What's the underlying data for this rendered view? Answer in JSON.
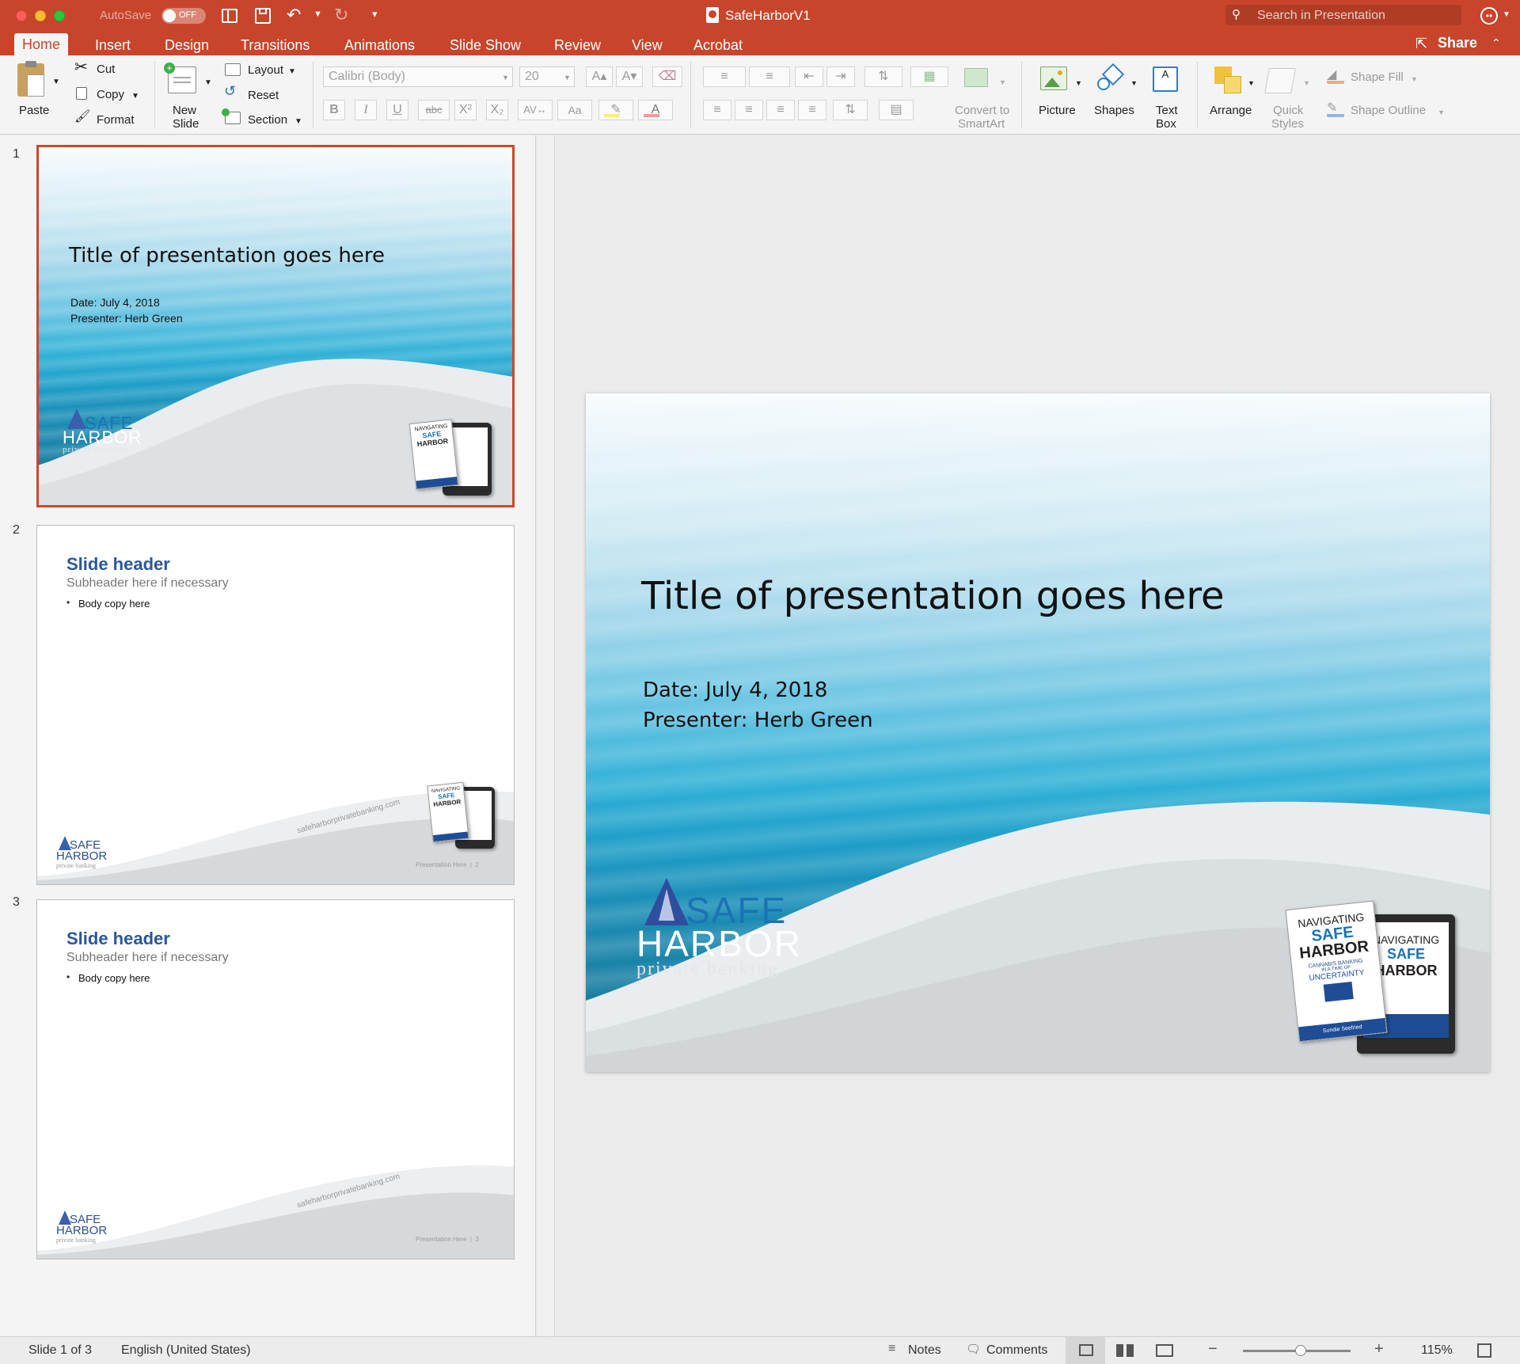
{
  "window": {
    "title": "SafeHarborV1",
    "autosave_label": "AutoSave",
    "autosave_state": "OFF",
    "search_placeholder": "Search in Presentation"
  },
  "tabs": [
    "Home",
    "Insert",
    "Design",
    "Transitions",
    "Animations",
    "Slide Show",
    "Review",
    "View",
    "Acrobat"
  ],
  "share_label": "Share",
  "ribbon": {
    "paste": "Paste",
    "cut": "Cut",
    "copy": "Copy",
    "format": "Format",
    "new_slide_1": "New",
    "new_slide_2": "Slide",
    "layout": "Layout",
    "reset": "Reset",
    "section": "Section",
    "font_name": "Calibri (Body)",
    "font_size": "20",
    "convert_1": "Convert to",
    "convert_2": "SmartArt",
    "picture": "Picture",
    "shapes": "Shapes",
    "textbox_1": "Text",
    "textbox_2": "Box",
    "arrange": "Arrange",
    "quick_1": "Quick",
    "quick_2": "Styles",
    "shape_fill": "Shape Fill",
    "shape_outline": "Shape Outline"
  },
  "slides": {
    "s1": {
      "num": "1",
      "title": "Title of presentation goes here",
      "date": "Date: July 4, 2018",
      "presenter": "Presenter: Herb Green"
    },
    "s2": {
      "num": "2",
      "header": "Slide header",
      "subheader": "Subheader here if necessary",
      "body": "Body copy here",
      "url": "safeharborprivatebanking.com",
      "footer": "Presentation Here  |  2"
    },
    "s3": {
      "num": "3",
      "header": "Slide header",
      "subheader": "Subheader here if necessary",
      "body": "Body copy here",
      "url": "safeharborprivatebanking.com",
      "footer": "Presentation Here  |  3"
    }
  },
  "main_slide": {
    "title": "Title of presentation goes here",
    "date": "Date: July 4, 2018",
    "presenter": "Presenter: Herb Green"
  },
  "logo": {
    "safe": "SAFE",
    "harbor": "HARBOR",
    "tagline": "private banking"
  },
  "book": {
    "line1": "NAVIGATING",
    "line2": "SAFE",
    "line3": "HARBOR",
    "line4": "CANNABIS BANKING",
    "line5": "IN A TIME OF",
    "line6": "UNCERTAINTY",
    "author": "Sundie Seefried"
  },
  "status": {
    "slide_of": "Slide 1 of 3",
    "language": "English (United States)",
    "notes": "Notes",
    "comments": "Comments",
    "zoom": "115%"
  },
  "colors": {
    "accent": "#c8452b",
    "slide_header": "#2b579a",
    "logo_blue": "#1a73b5"
  }
}
